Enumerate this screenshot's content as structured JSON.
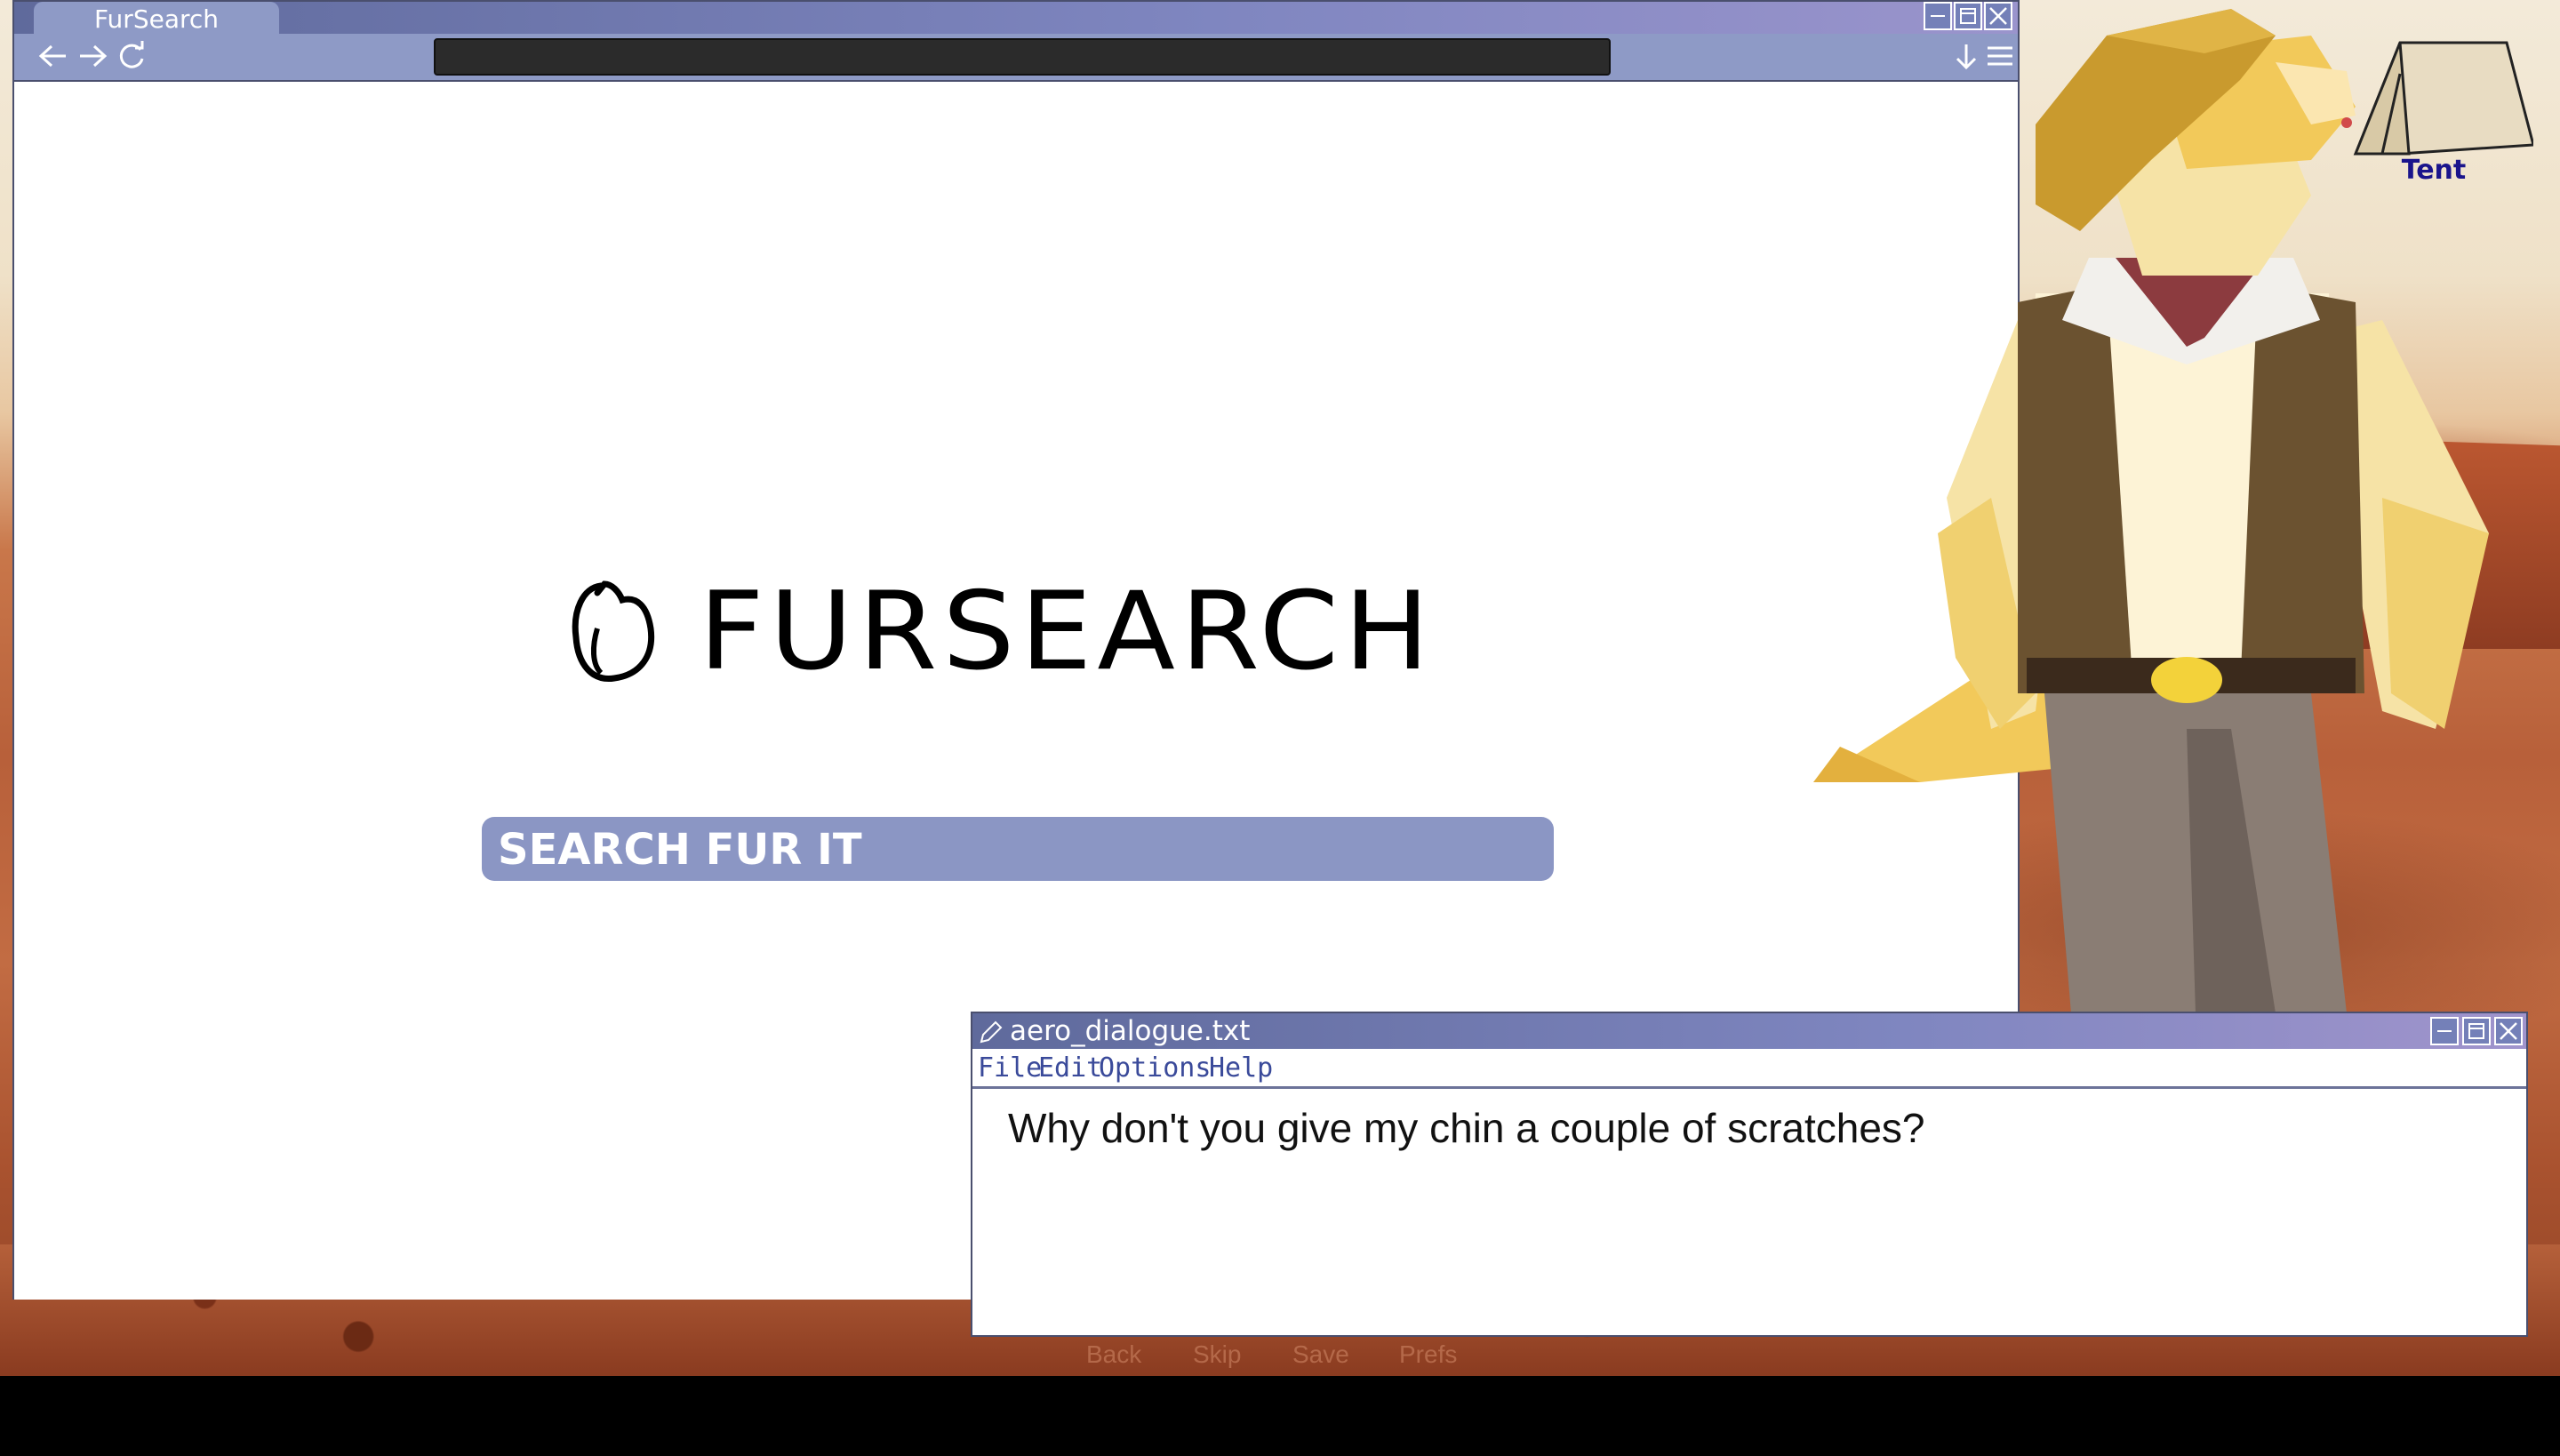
{
  "browser": {
    "tab_title": "FurSearch",
    "logo_text": "FURSEARCH",
    "search_placeholder": "SEARCH FUR IT"
  },
  "desktop": {
    "icons": [
      {
        "label": "Tent",
        "icon": "tent-icon"
      }
    ]
  },
  "dialogue_window": {
    "title": "aero_dialogue.txt",
    "menus": [
      {
        "label": "File"
      },
      {
        "label": "Edit"
      },
      {
        "label": "Options"
      },
      {
        "label": "Help"
      }
    ],
    "text": "Why don't you give my chin a couple of scratches?"
  },
  "quick_menu": [
    {
      "label": "Back"
    },
    {
      "label": "Skip"
    },
    {
      "label": "Save"
    },
    {
      "label": "Prefs"
    }
  ],
  "colors": {
    "titlebar": "#7f86c0",
    "toolbar": "#8e9ac6",
    "searchbox": "#8b96c4",
    "menu_text": "#3a4a9a",
    "icon_label": "#1a148c"
  }
}
